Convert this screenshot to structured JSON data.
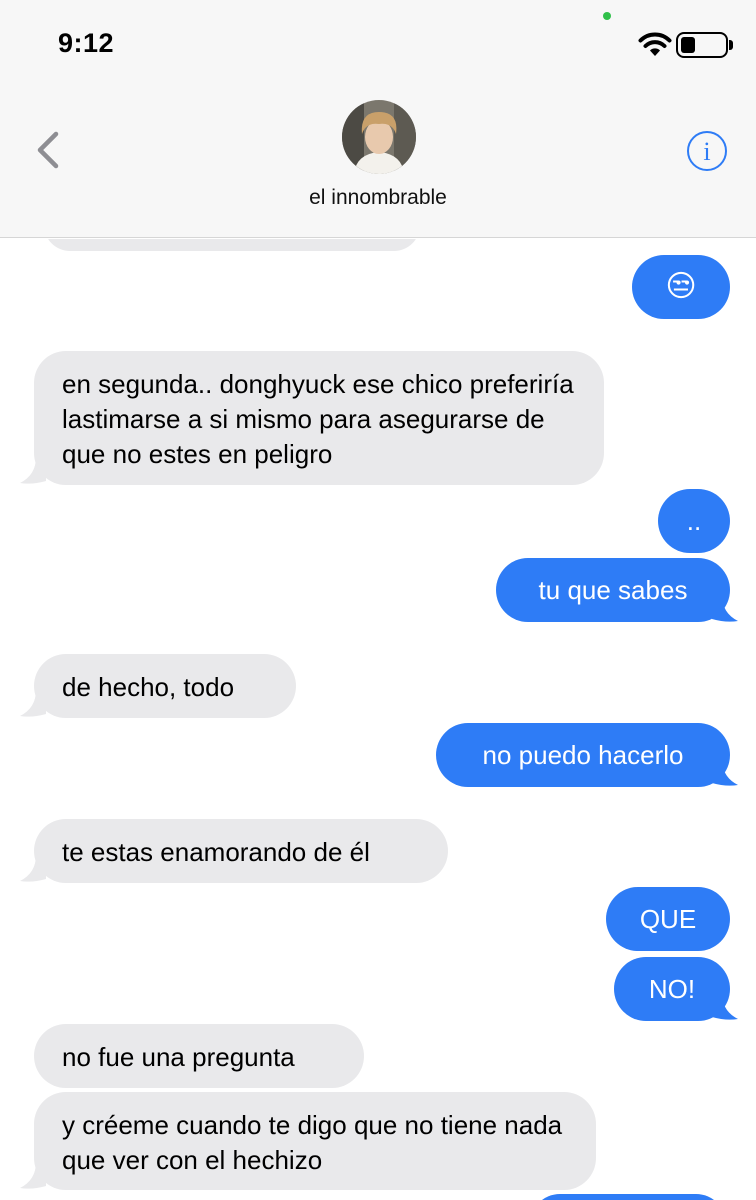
{
  "status": {
    "time": "9:12"
  },
  "header": {
    "contact_name": "el innombrable",
    "back_icon": "chevron-left-icon",
    "info_icon": "info-icon"
  },
  "colors": {
    "sent_bubble": "#2e7cf6",
    "received_bubble": "#e9e9eb",
    "accent": "#2e7cf6"
  },
  "messages": [
    {
      "from": "them",
      "text": ""
    },
    {
      "from": "me",
      "text": "😒"
    },
    {
      "from": "them",
      "text": "en segunda.. donghyuck ese chico preferiría lastimarse a si mismo para asegurarse de que no estes en peligro"
    },
    {
      "from": "me",
      "text": ".."
    },
    {
      "from": "me",
      "text": "tu que sabes"
    },
    {
      "from": "them",
      "text": "de hecho, todo"
    },
    {
      "from": "me",
      "text": "no puedo hacerlo"
    },
    {
      "from": "them",
      "text": "te estas enamorando de él"
    },
    {
      "from": "me",
      "text": "QUE"
    },
    {
      "from": "me",
      "text": "NO!"
    },
    {
      "from": "them",
      "text": "no fue una pregunta"
    },
    {
      "from": "them",
      "text": "y créeme cuando te digo que no tiene nada que ver con el hechizo"
    },
    {
      "from": "me",
      "text": ""
    }
  ]
}
